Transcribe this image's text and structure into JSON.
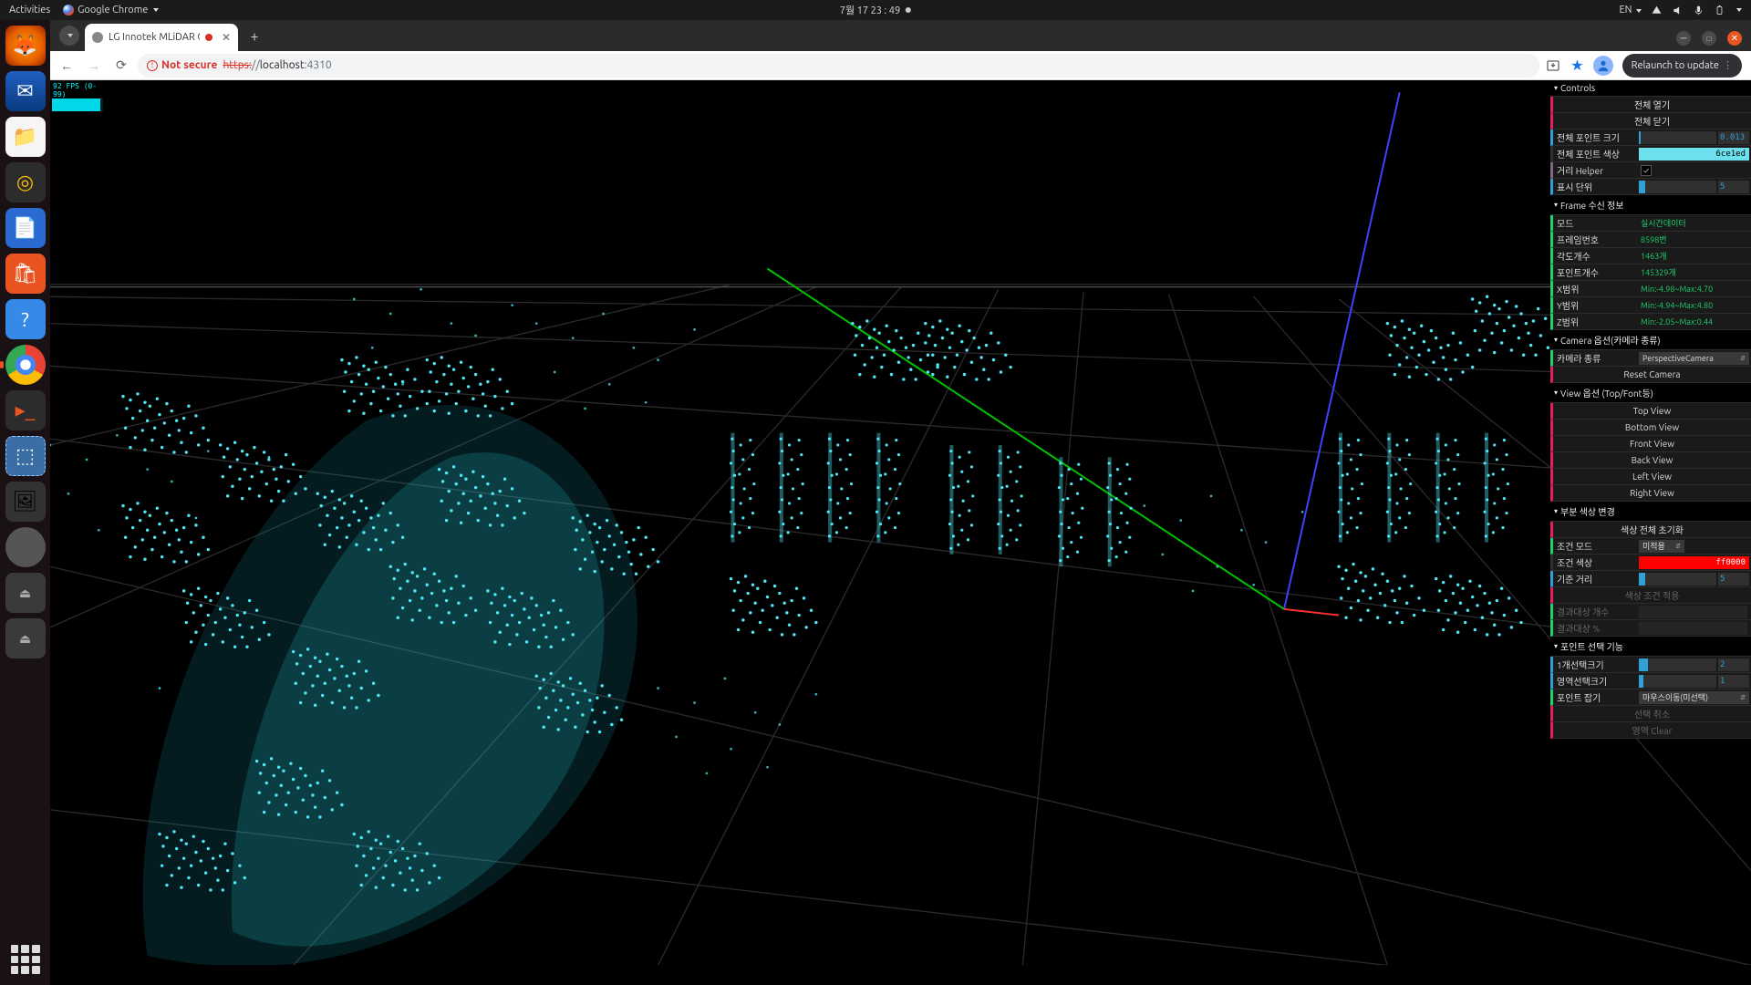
{
  "gnome": {
    "activities": "Activities",
    "app": "Google Chrome",
    "clock": "7월 17  23 : 49",
    "lang": "EN"
  },
  "tab": {
    "title": "LG Innotek MLiDAR C"
  },
  "url": {
    "not_secure": "Not secure",
    "scheme": "https:",
    "sep": "//",
    "host": "localhost",
    "port": ":4310"
  },
  "relaunch": "Relaunch to update",
  "fps": "92 FPS (0-99)",
  "gui": {
    "controls": {
      "title": "Controls",
      "open_all": "전체 열기",
      "close_all": "전체 닫기",
      "point_size_label": "전체 포인트 크기",
      "point_size": "0.013",
      "point_color_label": "전체 포인트 색상",
      "point_color_hex": "6ce1ed",
      "dist_helper_label": "거리 Helper",
      "display_unit_label": "표시 단위",
      "display_unit": "5"
    },
    "frame": {
      "title": "Frame 수신 정보",
      "mode_label": "모드",
      "mode": "실시간데이터",
      "frame_no_label": "프레임번호",
      "frame_no": "8598번",
      "angle_count_label": "각도개수",
      "angle_count": "1463개",
      "point_count_label": "포인트개수",
      "point_count": "145329개",
      "x_range_label": "X범위",
      "x_range": "Min:-4.98~Max:4.70",
      "y_range_label": "Y범위",
      "y_range": "Min:-4.94~Max:4.80",
      "z_range_label": "Z범위",
      "z_range": "Min:-2.05~Max:0.44"
    },
    "camera_opt": {
      "title": "Camera 옵션(카메라 종류)",
      "type_label": "카메라 종류",
      "type": "PerspectiveCamera",
      "reset": "Reset Camera"
    },
    "view_opt": {
      "title": "View 옵션 (Top/Font등)",
      "top": "Top View",
      "bottom": "Bottom View",
      "front": "Front View",
      "back": "Back View",
      "left": "Left View",
      "right": "Right View"
    },
    "color_change": {
      "title": "부분 색상 변경",
      "reset_all": "색상 전체 초기화",
      "cond_mode_label": "조건 모드",
      "cond_mode": "미적용",
      "cond_color_label": "조건 색상",
      "cond_color_hex": "ff0000",
      "ref_dist_label": "기준 거리",
      "ref_dist": "5",
      "apply": "색상 조건 적용",
      "result_count_label": "결과대상 개수",
      "result_pct_label": "결과대상 %"
    },
    "point_sel": {
      "title": "포인트 선택 기능",
      "one_size_label": "1개선택크기",
      "one_size": "2",
      "area_size_label": "영역선택크기",
      "area_size": "1",
      "grip_label": "포인트 잡기",
      "grip": "마우스이동(미선택)",
      "cancel": "선택 취소",
      "clear": "영역 Clear"
    }
  }
}
